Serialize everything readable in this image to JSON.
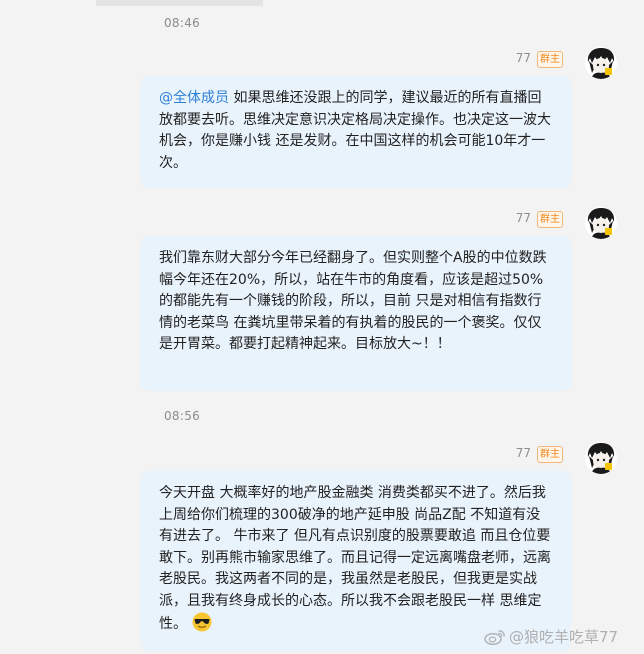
{
  "timestamps": [
    "08:46",
    "08:56"
  ],
  "messages": [
    {
      "sender": "77",
      "badge": "群主",
      "mention": "@全体成员",
      "text": " 如果思维还没跟上的同学，建议最近的所有直播回放都要去听。思维决定意识决定格局决定操作。也决定这一波大机会，你是赚小钱 还是发财。在中国这样的机会可能10年才一次。"
    },
    {
      "sender": "77",
      "badge": "群主",
      "text": "我们靠东财大部分今年已经翻身了。但实则整个A股的中位数跌幅今年还在20%，所以，站在牛市的角度看，应该是超过50%的都能先有一个赚钱的阶段，所以，目前 只是对相信有指数行情的老菜鸟 在粪坑里带呆着的有执着的股民的一个褒奖。仅仅是开胃菜。都要打起精神起来。目标放大~！！"
    },
    {
      "sender": "77",
      "badge": "群主",
      "text": "今天开盘 大概率好的地产股金融类 消费类都买不进了。然后我上周给你们梳理的300破净的地产延申股 尚品Z配 不知道有没有进去了。 牛市来了 但凡有点识别度的股票要敢追 而且仓位要敢下。别再熊市输家思维了。而且记得一定远离嘴盘老师，远离老股民。我这两者不同的是，我虽然是老股民，但我更是实战派，且我有终身成长的心态。所以我不会跟老股民一样  思维定性。",
      "emoji": "sunglasses-emoji"
    }
  ],
  "watermark": "@狼吃羊吃草77",
  "colors": {
    "background": "#f3f3f3",
    "bubble": "#e9f3fc",
    "mention": "#2b7fd6",
    "badge": "#f08a1c"
  }
}
